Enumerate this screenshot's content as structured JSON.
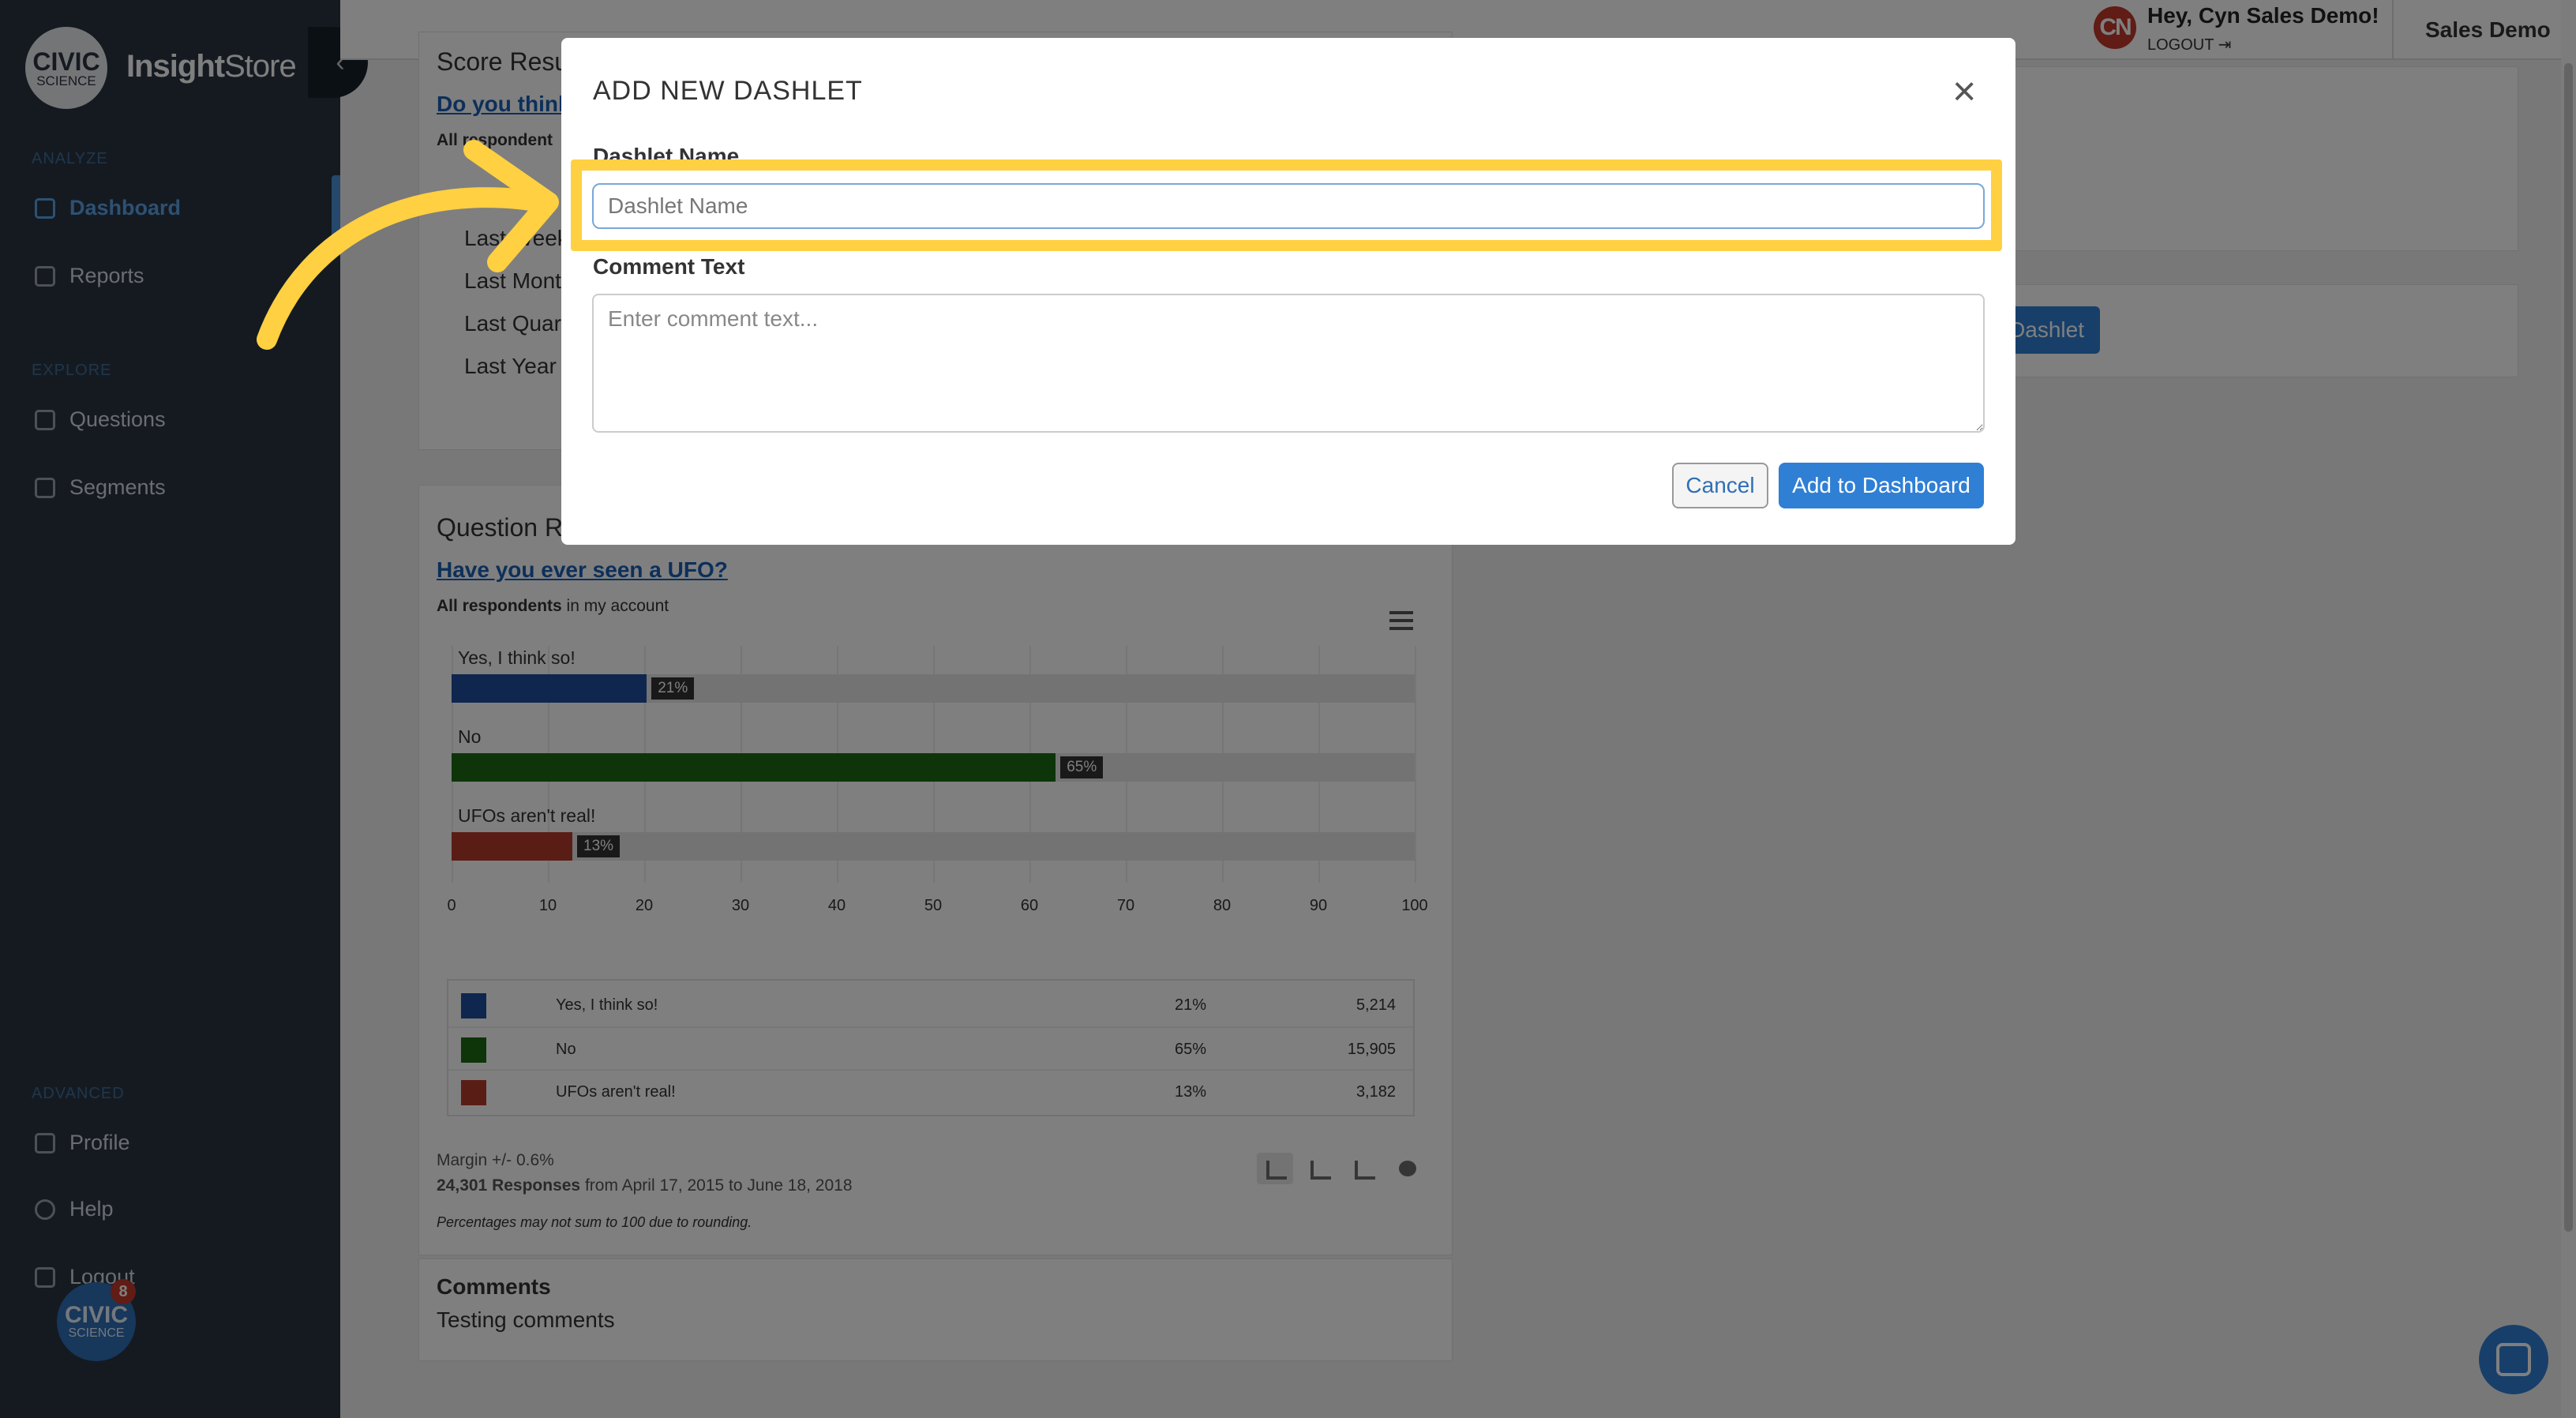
{
  "sidebar": {
    "logo": {
      "line1": "CIVIC",
      "line2": "SCIENCE",
      "app_name_bold": "Insight",
      "app_name_rest": "Store"
    },
    "sections": {
      "analyze": "ANALYZE",
      "explore": "EXPLORE",
      "advanced": "ADVANCED"
    },
    "items": [
      {
        "label": "Dashboard",
        "icon": "dashboard-icon",
        "active": true
      },
      {
        "label": "Reports",
        "icon": "reports-icon"
      },
      {
        "label": "Questions",
        "icon": "questions-icon"
      },
      {
        "label": "Segments",
        "icon": "segments-icon"
      },
      {
        "label": "Profile",
        "icon": "profile-icon"
      },
      {
        "label": "Help",
        "icon": "help-icon"
      },
      {
        "label": "Logout",
        "icon": "logout-icon"
      }
    ],
    "chat": {
      "line1": "CIVIC",
      "line2": "SCIENCE",
      "badge": "8"
    }
  },
  "header": {
    "initials": "CN",
    "greeting": "Hey, Cyn Sales Demo!",
    "logout": "LOGOUT",
    "account": "Sales Demo"
  },
  "score_card": {
    "title": "Score Resu",
    "question": "Do you think",
    "respondents": "All respondent",
    "timeframes": [
      "Last Week",
      "Last Mont",
      "Last Quar",
      "Last Year"
    ]
  },
  "question_card": {
    "title": "Question R",
    "question": "Have you ever seen a UFO?",
    "respondents_bold": "All respondents",
    "respondents_rest": " in my account",
    "margin": "Margin +/- 0.6%",
    "responses_bold": "24,301 Responses",
    "responses_rest": " from April 17, 2015 to June 18, 2018",
    "note": "Percentages may not sum to 100 due to rounding."
  },
  "comments_card": {
    "title": "Comments",
    "text": "Testing comments"
  },
  "right_panel": {
    "button_fragment": "Dashlet"
  },
  "chart_data": {
    "type": "bar",
    "orientation": "horizontal",
    "categories": [
      "Yes, I think so!",
      "No",
      "UFOs aren't real!"
    ],
    "values": [
      21,
      65,
      13
    ],
    "value_labels": [
      "21%",
      "65%",
      "13%"
    ],
    "counts": [
      "5,214",
      "15,905",
      "3,182"
    ],
    "colors": [
      "#1f4c9c",
      "#1c6b12",
      "#b53b2a"
    ],
    "xlim": [
      0,
      100
    ],
    "ticks": [
      "0",
      "10",
      "20",
      "30",
      "40",
      "50",
      "60",
      "70",
      "80",
      "90",
      "100"
    ],
    "legend_placement": "bottom"
  },
  "modal": {
    "title": "ADD NEW DASHLET",
    "name_label": "Dashlet Name",
    "name_placeholder": "Dashlet Name",
    "name_value": "",
    "comment_label": "Comment Text",
    "comment_placeholder": "Enter comment text...",
    "cancel": "Cancel",
    "submit": "Add to Dashboard",
    "close_icon": "close-icon"
  },
  "annotation": {
    "highlight_color": "#ffd041"
  }
}
